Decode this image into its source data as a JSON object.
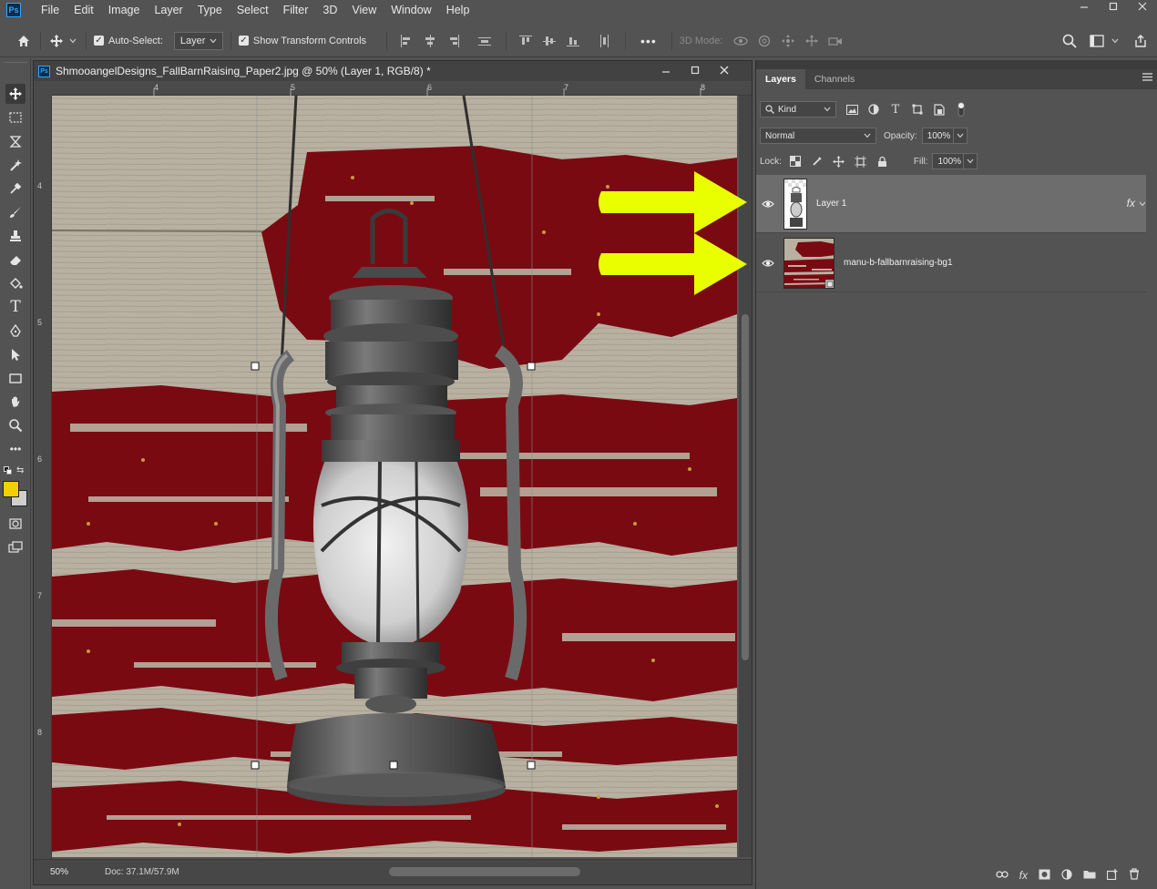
{
  "menu": {
    "logo": "Ps",
    "items": [
      "File",
      "Edit",
      "Image",
      "Layer",
      "Type",
      "Select",
      "Filter",
      "3D",
      "View",
      "Window",
      "Help"
    ]
  },
  "options_bar": {
    "auto_select_label": "Auto-Select:",
    "auto_select_value": "Layer",
    "show_transform_label": "Show Transform Controls",
    "mode_3d_label": "3D Mode:",
    "more_label": "•••"
  },
  "document": {
    "title": "ShmooangelDesigns_FallBarnRaising_Paper2.jpg @ 50% (Layer 1, RGB/8) *",
    "zoom": "50%",
    "doc_size": "Doc: 37.1M/57.9M",
    "ruler_top": [
      "4",
      "5",
      "6",
      "7",
      "8"
    ],
    "ruler_left": [
      "4",
      "5",
      "6",
      "7",
      "8"
    ]
  },
  "layers_panel": {
    "tabs": [
      "Layers",
      "Channels"
    ],
    "filter_kind": "Kind",
    "blend_mode": "Normal",
    "opacity_label": "Opacity:",
    "opacity_value": "100%",
    "lock_label": "Lock:",
    "fill_label": "Fill:",
    "fill_value": "100%",
    "layers": [
      {
        "name": "Layer 1",
        "selected": true,
        "fx": "fx"
      },
      {
        "name": "manu-b-fallbarnraising-bg1",
        "selected": false
      }
    ]
  },
  "colors": {
    "foreground": "#f2cf00",
    "background": "#cfcfcf",
    "arrow": "#e9ff00",
    "barn_red": "#7a0a12",
    "wood": "#b8b1a1"
  },
  "icons": {
    "home": "home-icon",
    "move": "move-icon",
    "search": "search-icon",
    "share": "share-icon"
  }
}
